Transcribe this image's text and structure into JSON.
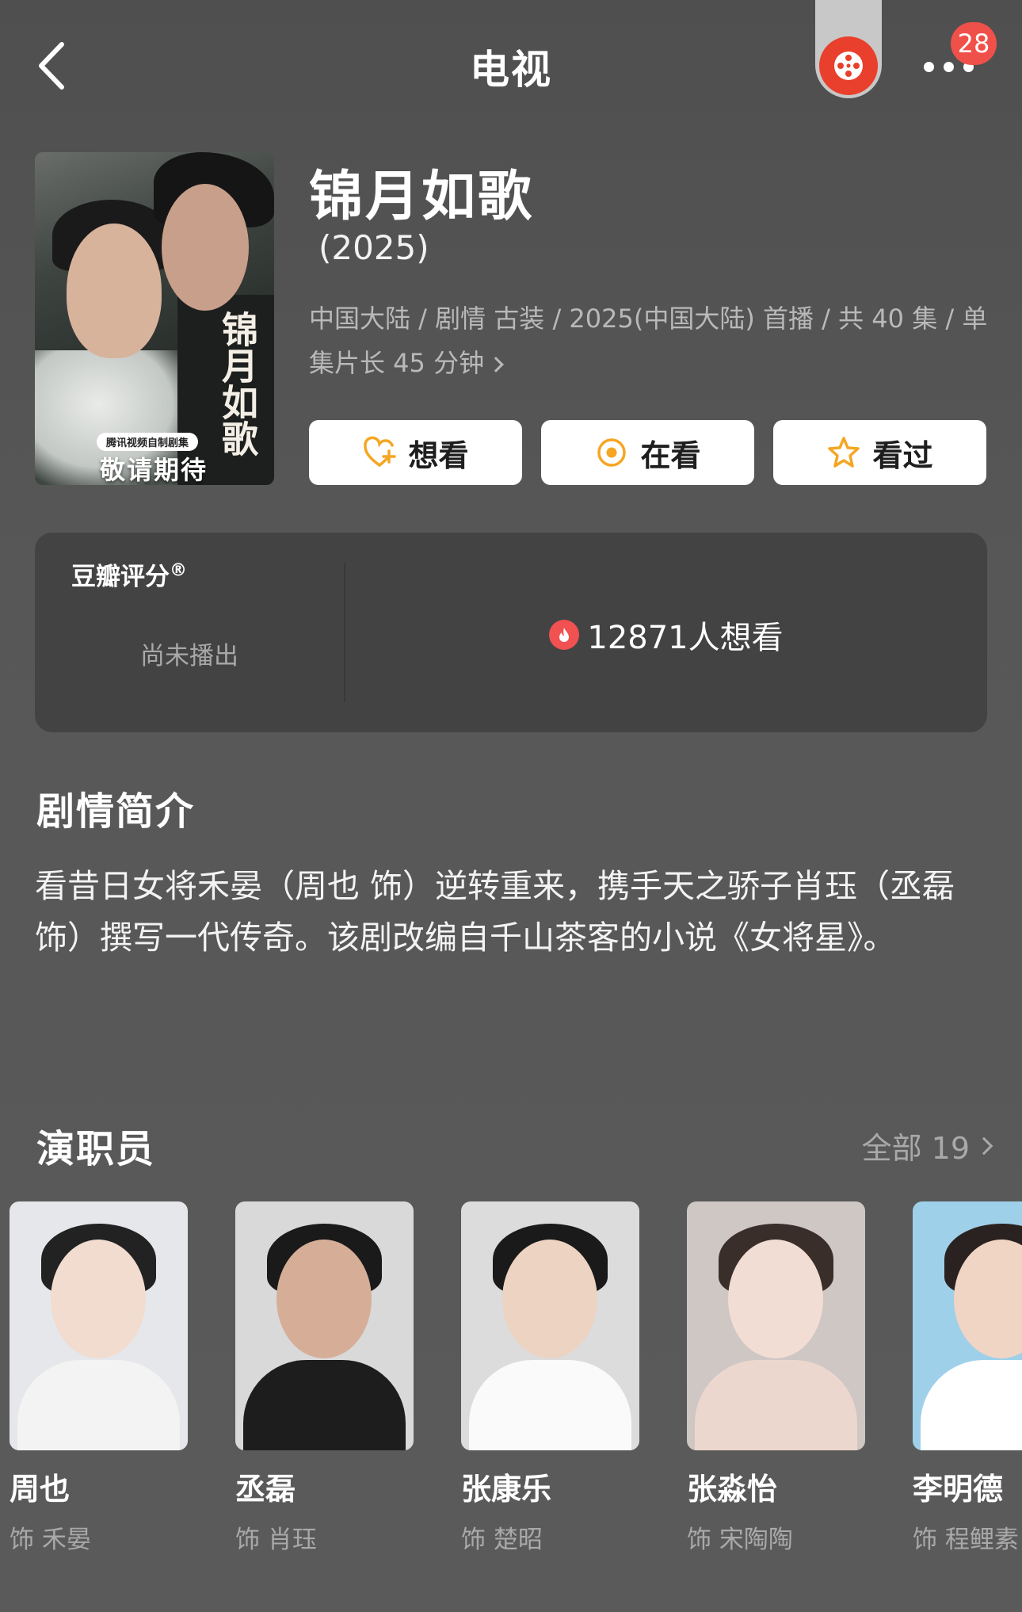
{
  "header": {
    "title": "电视",
    "notification_count": "28"
  },
  "poster": {
    "calligraphy": "锦月如歌",
    "badge": "腾讯视频自制剧集",
    "tagline": "敬请期待"
  },
  "show": {
    "name": "锦月如歌",
    "year": "(2025)",
    "meta": "中国大陆 / 剧情 古装 / 2025(中国大陆) 首播 / 共 40 集 / 单集片长 45 分钟"
  },
  "actions": [
    {
      "label": "想看",
      "icon": "heart-plus-icon"
    },
    {
      "label": "在看",
      "icon": "target-icon"
    },
    {
      "label": "看过",
      "icon": "star-icon"
    }
  ],
  "rating": {
    "label": "豆瓣评分",
    "label_mark": "®",
    "status": "尚未播出",
    "want_count": "12871人想看"
  },
  "synopsis": {
    "title": "剧情简介",
    "text": "看昔日女将禾晏（周也 饰）逆转重来，携手天之骄子肖珏（丞磊 饰）撰写一代传奇。该剧改编自千山茶客的小说《女将星》。"
  },
  "cast": {
    "title": "演职员",
    "all_label": "全部 19",
    "members": [
      {
        "name": "周也",
        "role": "饰 禾晏"
      },
      {
        "name": "丞磊",
        "role": "饰 肖珏"
      },
      {
        "name": "张康乐",
        "role": "饰 楚昭"
      },
      {
        "name": "张淼怡",
        "role": "饰 宋陶陶"
      },
      {
        "name": "李明德",
        "role": "饰 程鲤素"
      }
    ]
  },
  "colors": {
    "background": "#585858",
    "card": "#434343",
    "accent_orange": "#f5a623",
    "notif_red": "#f0504a"
  }
}
